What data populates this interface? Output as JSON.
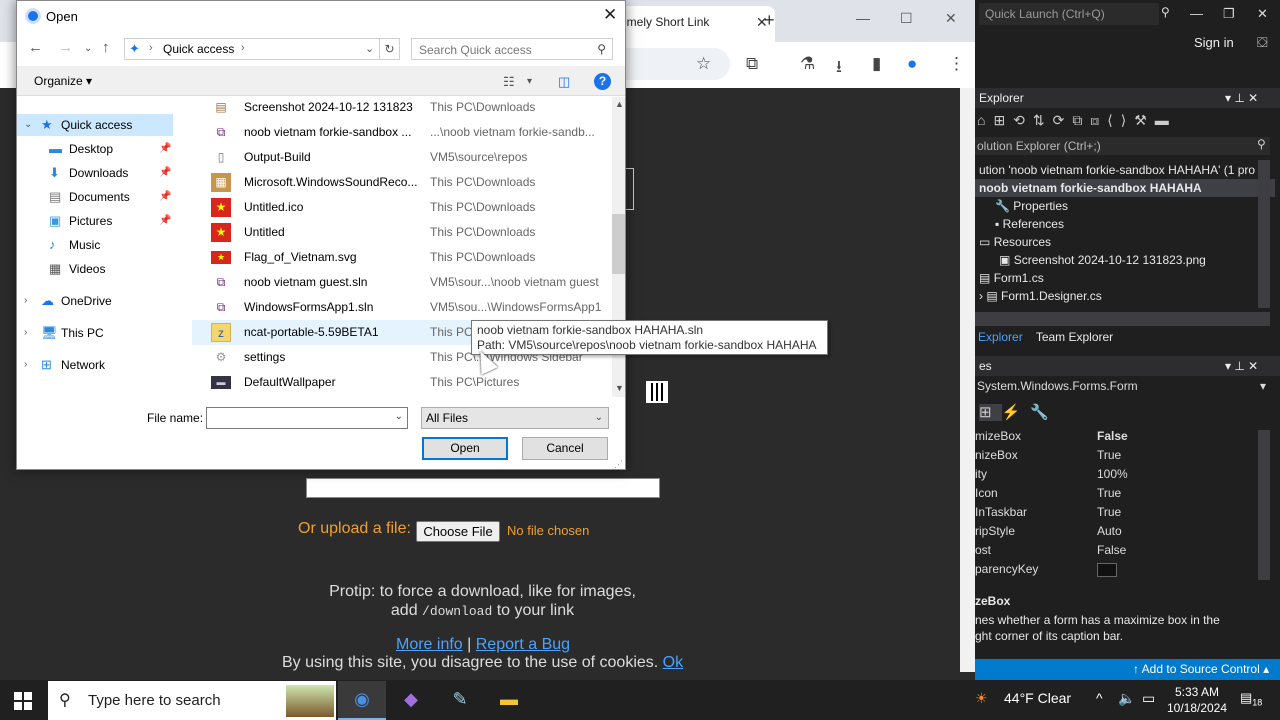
{
  "dialog": {
    "title": "Open",
    "address": {
      "crumb": "Quick access"
    },
    "search_placeholder": "Search Quick access",
    "organize_label": "Organize",
    "nav": [
      {
        "label": "Quick access",
        "icon": "star-icon",
        "selected": true
      },
      {
        "label": "Desktop",
        "icon": "desktop-icon",
        "pinned": true
      },
      {
        "label": "Downloads",
        "icon": "download-icon",
        "pinned": true
      },
      {
        "label": "Documents",
        "icon": "document-icon",
        "pinned": true
      },
      {
        "label": "Pictures",
        "icon": "picture-icon",
        "pinned": true
      },
      {
        "label": "Music",
        "icon": "music-icon"
      },
      {
        "label": "Videos",
        "icon": "video-icon"
      },
      {
        "label": "OneDrive",
        "icon": "cloud-icon"
      },
      {
        "label": "This PC",
        "icon": "computer-icon"
      },
      {
        "label": "Network",
        "icon": "network-icon"
      }
    ],
    "files": [
      {
        "name": "Screenshot 2024-10-12 131823",
        "path": "This PC\\Downloads",
        "icon": "image-file-icon"
      },
      {
        "name": "noob vietnam forkie-sandbox ...",
        "path": "...\\noob vietnam forkie-sandb...",
        "icon": "vs-solution-icon"
      },
      {
        "name": "Output-Build",
        "path": "VM5\\source\\repos",
        "icon": "text-file-icon"
      },
      {
        "name": "Microsoft.WindowsSoundReco...",
        "path": "This PC\\Downloads",
        "icon": "package-icon"
      },
      {
        "name": "Untitled.ico",
        "path": "This PC\\Downloads",
        "icon": "vietnam-flag-icon"
      },
      {
        "name": "Untitled",
        "path": "This PC\\Downloads",
        "icon": "vietnam-flag-icon"
      },
      {
        "name": "Flag_of_Vietnam.svg",
        "path": "This PC\\Downloads",
        "icon": "vietnam-flag-icon"
      },
      {
        "name": "noob vietnam guest.sln",
        "path": "VM5\\sour...\\noob vietnam guest",
        "icon": "vs-solution-icon"
      },
      {
        "name": "WindowsFormsApp1.sln",
        "path": "VM5\\sou...\\WindowsFormsApp1",
        "icon": "vs-solution-icon"
      },
      {
        "name": "ncat-portable-5.59BETA1",
        "path": "This PC",
        "icon": "zip-folder-icon"
      },
      {
        "name": "settings",
        "path": "This PC\\...\\Windows Sidebar",
        "icon": "settings-file-icon"
      },
      {
        "name": "DefaultWallpaper",
        "path": "This PC\\Pictures",
        "icon": "image-file-icon"
      }
    ],
    "tooltip": {
      "line1": "noob vietnam forkie-sandbox HAHAHA.sln",
      "line2": "Path: VM5\\source\\repos\\noob vietnam forkie-sandbox HAHAHA"
    },
    "filename_label": "File name:",
    "filename_value": "",
    "filter_value": "All Files",
    "open_label": "Open",
    "cancel_label": "Cancel"
  },
  "browser": {
    "tab_title": "emely Short Link",
    "page": {
      "upload_label": "Or upload a file:",
      "choose_file": "Choose File",
      "no_file": "No file chosen",
      "protip_line1": "Protip: to force a download, like for images,",
      "protip_add": "add",
      "protip_code": "/download",
      "protip_tail": "to your link",
      "more_info": "More info",
      "report_bug": "Report a Bug",
      "cookie_text": "By using this site, you disagree to the use of cookies.",
      "cookie_ok": "Ok"
    }
  },
  "vs": {
    "quick_launch": "Quick Launch (Ctrl+Q)",
    "sign_in": "Sign in",
    "explorer_title": "Explorer",
    "solution_search": "olution Explorer (Ctrl+;)",
    "tree": [
      "ution 'noob vietnam forkie-sandbox HAHAHA' (1 pro",
      "noob vietnam forkie-sandbox HAHAHA",
      "Properties",
      "References",
      "Resources",
      "Screenshot 2024-10-12 131823.png",
      "Form1.cs",
      "Form1.Designer.cs"
    ],
    "tabs": [
      "Explorer",
      "Team Explorer"
    ],
    "properties_title": "es",
    "properties_object": "System.Windows.Forms.Form",
    "props": [
      {
        "k": "mizeBox",
        "v": "False"
      },
      {
        "k": "nizeBox",
        "v": "True"
      },
      {
        "k": "ity",
        "v": "100%"
      },
      {
        "k": "Icon",
        "v": "True"
      },
      {
        "k": "InTaskbar",
        "v": "True"
      },
      {
        "k": "ripStyle",
        "v": "Auto"
      },
      {
        "k": "ost",
        "v": "False"
      },
      {
        "k": "parencyKey",
        "v": ""
      }
    ],
    "desc_title": "zeBox",
    "desc_line1": "nes whether a form has a maximize box in the",
    "desc_line2": "ght corner of its caption bar.",
    "source_control": "Add to Source Control"
  },
  "taskbar": {
    "search_placeholder": "Type here to search",
    "weather": "44°F  Clear",
    "time": "5:33 AM",
    "date": "10/18/2024",
    "notifications": "18"
  }
}
